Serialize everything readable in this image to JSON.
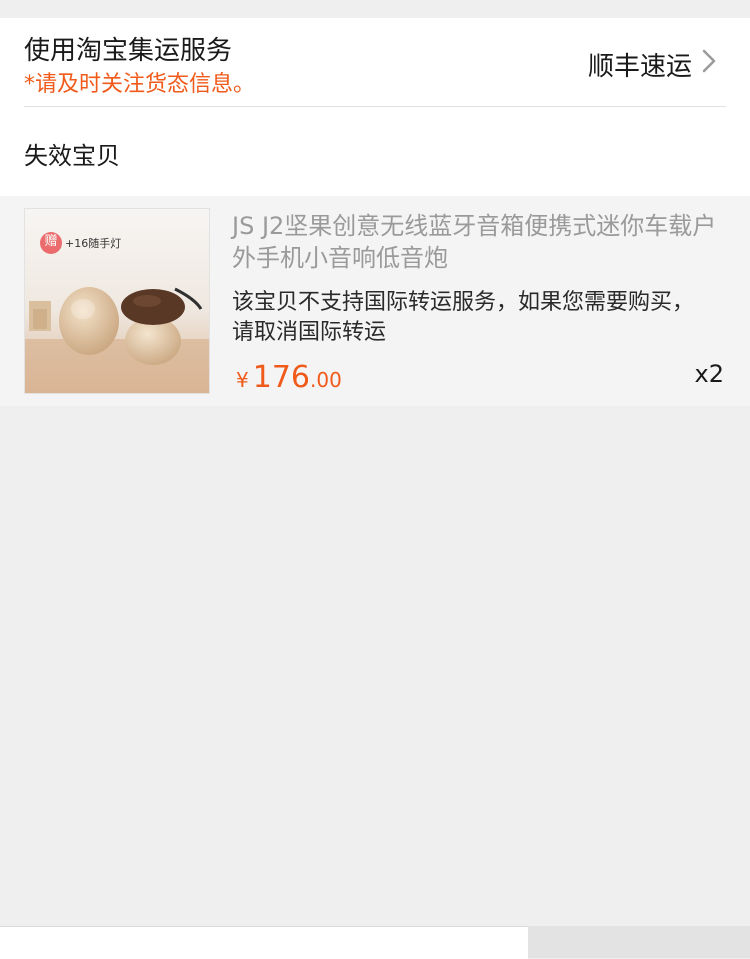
{
  "shipping": {
    "title": "使用淘宝集运服务",
    "note": "*请及时关注货态信息。",
    "method": "顺丰速运"
  },
  "invalid_section": {
    "label": "失效宝贝"
  },
  "item": {
    "title": "JS J2坚果创意无线蓝牙音箱便携式迷你车载户外手机小音响低音炮",
    "warning": "该宝贝不支持国际转运服务，如果您需要购买，请取消国际转运",
    "price_symbol": "¥",
    "price_integer": "176",
    "price_decimal": ".00",
    "quantity": "x2",
    "image_badge_char": "赠",
    "image_badge_text": "+16随手灯"
  },
  "colors": {
    "accent": "#f05a1a",
    "card_bg": "#f4f4f4",
    "page_bg": "#efefef"
  }
}
